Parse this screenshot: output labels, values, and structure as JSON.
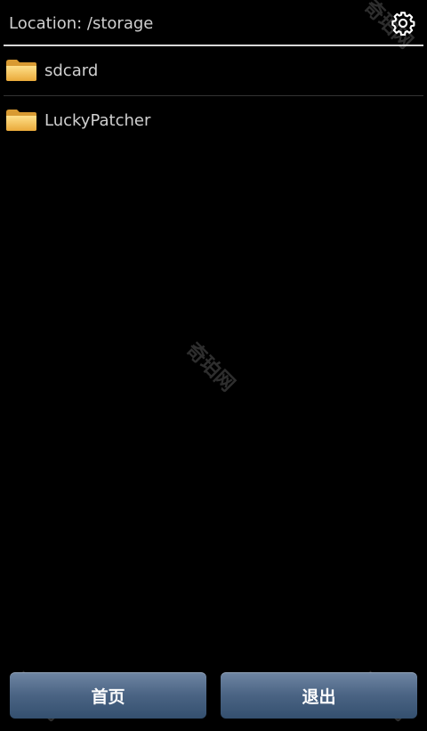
{
  "header": {
    "location": "Location: /storage",
    "settings_icon": "gear-icon"
  },
  "list": {
    "items": [
      {
        "label": "sdcard",
        "icon": "folder-icon"
      },
      {
        "label": "LuckyPatcher",
        "icon": "folder-icon"
      }
    ]
  },
  "footer": {
    "home_label": "首页",
    "exit_label": "退出"
  },
  "watermark": "奇珀网",
  "colors": {
    "background": "#000000",
    "button": "#4a6383",
    "folder": "#f2c15a"
  }
}
